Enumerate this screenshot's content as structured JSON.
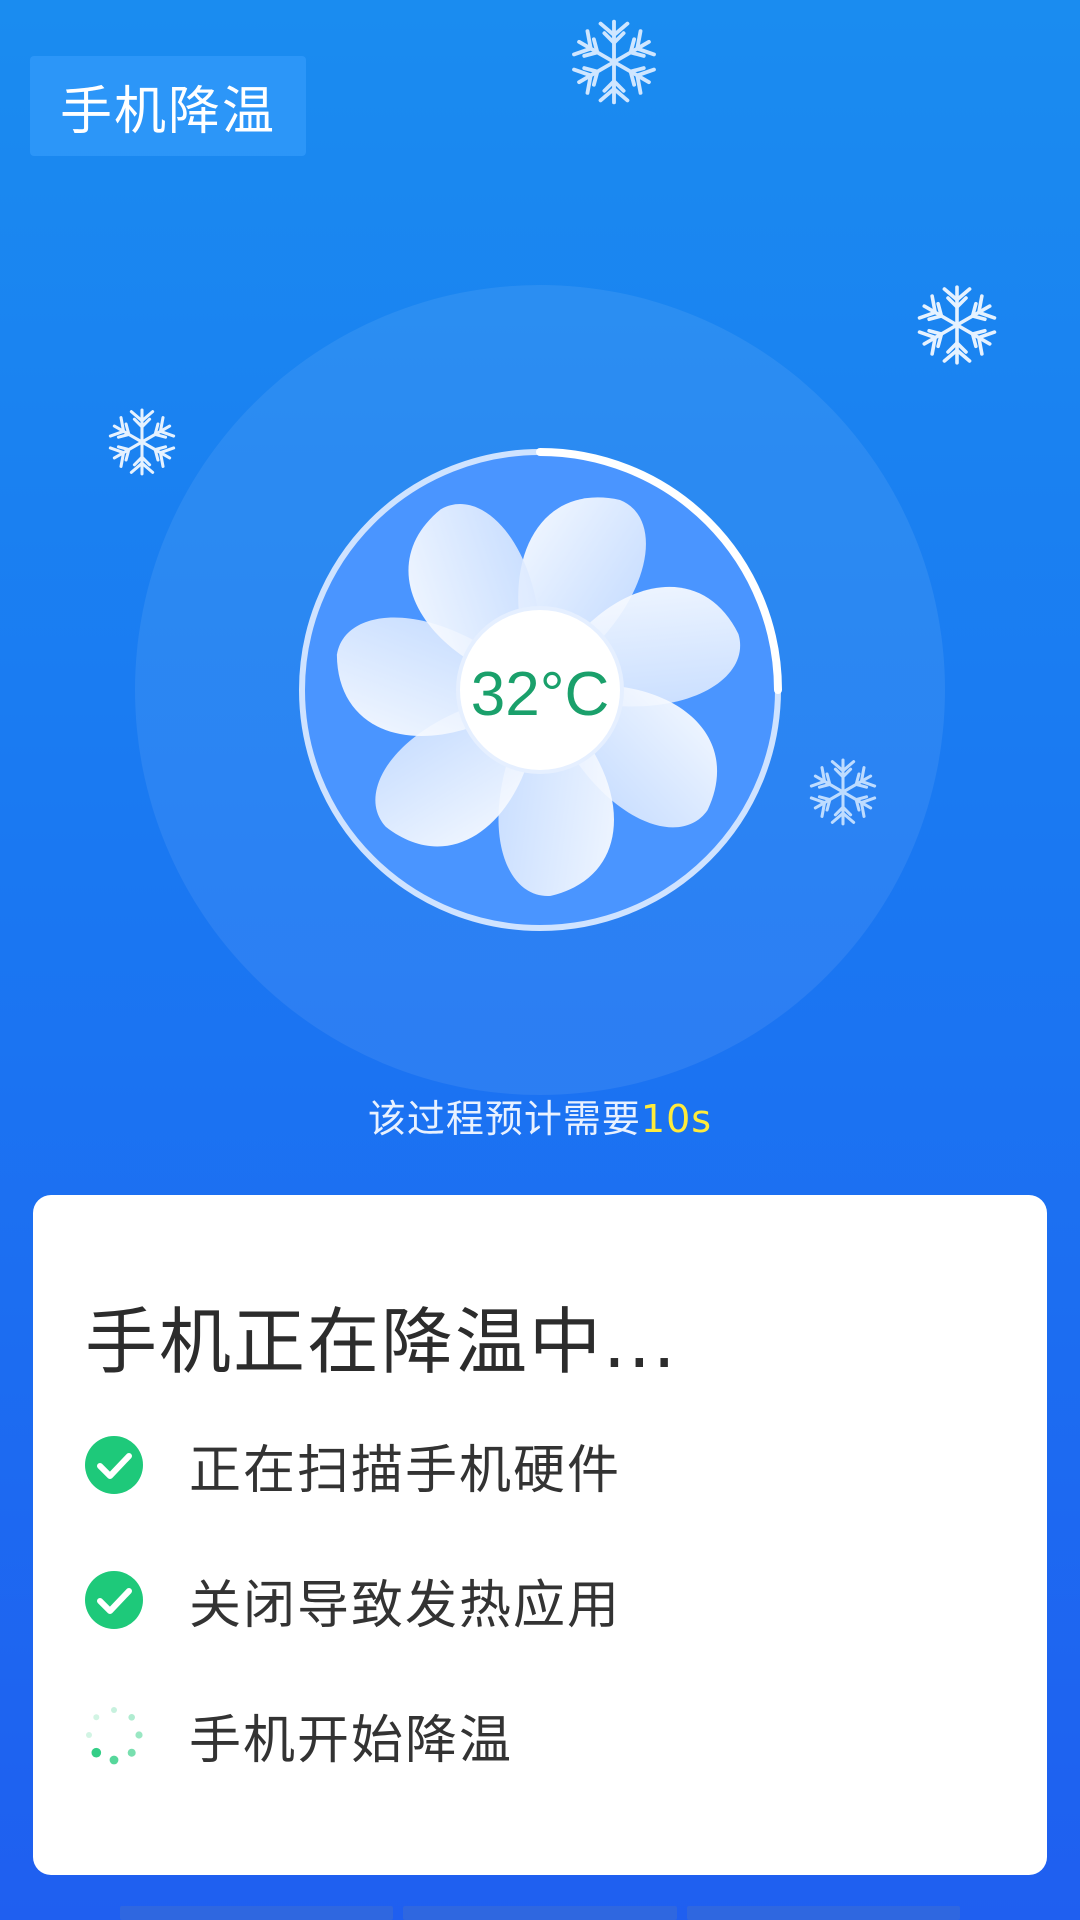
{
  "header": {
    "title": "手机降温"
  },
  "fan": {
    "temperature": "32°C"
  },
  "note": {
    "prefix": "该过程预计需要",
    "time": "10s"
  },
  "card": {
    "title": "手机正在降温中...",
    "steps": [
      {
        "label": "正在扫描手机硬件",
        "status": "done"
      },
      {
        "label": "关闭导致发热应用",
        "status": "done"
      },
      {
        "label": "手机开始降温",
        "status": "loading"
      }
    ]
  },
  "colors": {
    "accent_green": "#1ec97a",
    "highlight_yellow": "#ffeb3b",
    "bg_blue": "#1a78f2"
  }
}
